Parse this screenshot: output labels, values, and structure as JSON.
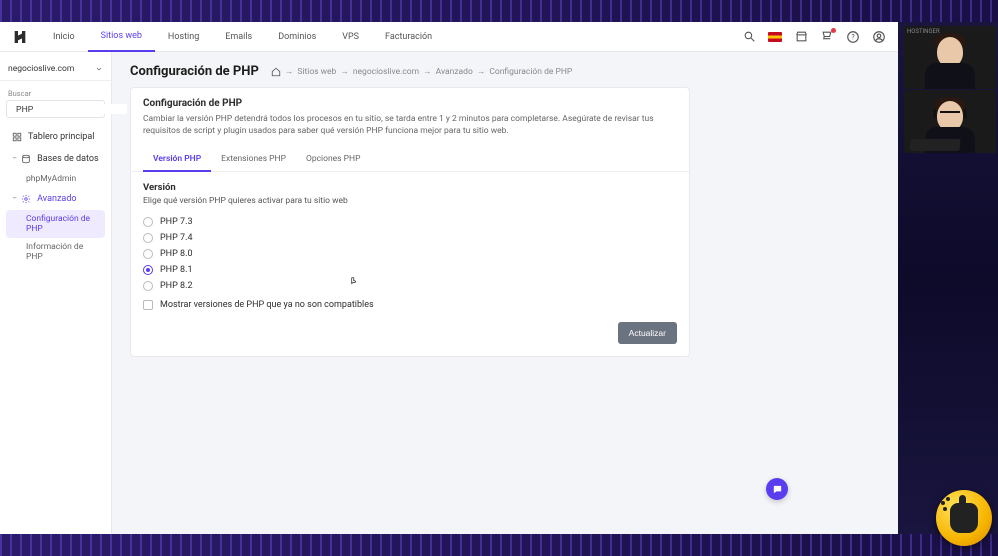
{
  "topnav": {
    "items": [
      "Inicio",
      "Sitios web",
      "Hosting",
      "Emails",
      "Dominios",
      "VPS",
      "Facturación"
    ],
    "active_index": 1
  },
  "sidebar": {
    "site_name": "negocioslive.com",
    "search_label": "Buscar",
    "search_value": "PHP",
    "item_dashboard": "Tablero principal",
    "item_databases": "Bases de datos",
    "sub_phpmyadmin": "phpMyAdmin",
    "item_advanced": "Avanzado",
    "sub_php_config": "Configuración de PHP",
    "sub_php_info": "Información de PHP"
  },
  "breadcrumb": {
    "sites": "Sitios web",
    "domain": "negocioslive.com",
    "section": "Avanzado",
    "page": "Configuración de PHP"
  },
  "page": {
    "title": "Configuración de PHP",
    "card_title": "Configuración de PHP",
    "card_desc": "Cambiar la versión PHP detendrá todos los procesos en tu sitio, se tarda entre 1 y 2 minutos para completarse. Asegúrate de revisar tus requisitos de script y plugin usados para saber qué versión PHP funciona mejor para tu sitio web.",
    "tabs": [
      "Versión PHP",
      "Extensiones PHP",
      "Opciones PHP"
    ],
    "active_tab": 0,
    "section_heading": "Versión",
    "section_desc": "Elige qué versión PHP quieres activar para tu sitio web",
    "options": [
      "PHP 7.3",
      "PHP 7.4",
      "PHP 8.0",
      "PHP 8.1",
      "PHP 8.2"
    ],
    "selected_index": 3,
    "legacy_toggle": "Mostrar versiones de PHP que ya no son compatibles",
    "submit": "Actualizar"
  },
  "overlay": {
    "cam_tag": "HOSTINGER"
  }
}
